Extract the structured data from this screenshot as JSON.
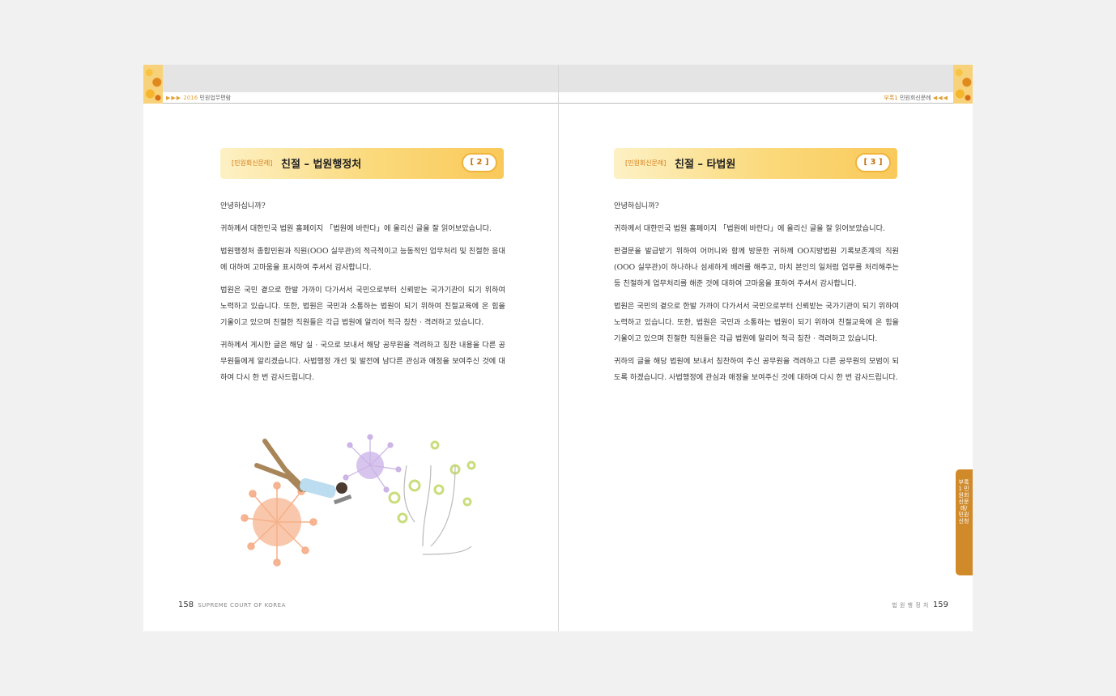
{
  "left_page": {
    "running_head": {
      "arrows": "▶▶▶",
      "year": "2016",
      "title": "민원업무편람"
    },
    "title_bar": {
      "category": "[민원회신문례]",
      "title": "친절 – 법원행정처",
      "number": "[ 2 ]"
    },
    "paragraphs": [
      "안녕하십니까?",
      "귀하께서 대한민국 법원 홈페이지 「법원에 바란다」에 올리신 글을 잘 읽어보았습니다.",
      "법원행정처 종합민원과 직원(OOO 실무관)의 적극적이고 능동적인 업무처리 및 친절한 응대에 대하여 고마움을 표시하여 주셔서 감사합니다.",
      "법원은 국민 곁으로 한발 가까이 다가서서 국민으로부터 신뢰받는 국가기관이 되기 위하여 노력하고 있습니다. 또한, 법원은 국민과 소통하는 법원이 되기 위하여 친절교육에 온 힘을 기울이고 있으며 친절한 직원들은 각급 법원에 알리어 적극 칭찬 · 격려하고 있습니다.",
      "귀하께서 게시한 글은 해당 실 · 국으로 보내서 해당 공무원을 격려하고 칭찬 내용을 다른 공무원들에게 알리겠습니다. 사법행정 개선 및 발전에 남다른 관심과 애정을 보여주신 것에 대하여 다시 한 번 감사드립니다."
    ],
    "footer": {
      "page_number": "158",
      "subtitle": "SUPREME COURT OF KOREA"
    }
  },
  "right_page": {
    "running_head": {
      "part": "부록1",
      "title": "민원회신문례",
      "arrows": "◀◀◀"
    },
    "title_bar": {
      "category": "[민원회신문례]",
      "title": "친절 – 타법원",
      "number": "[ 3 ]"
    },
    "paragraphs": [
      "안녕하십니까?",
      "귀하께서 대한민국 법원 홈페이지 「법원에 바란다」에 올리신 글을 잘 읽어보았습니다.",
      "판결문을 발급받기 위하여 어머니와 함께 방문한 귀하께 OO지방법원 기록보존계의 직원(OOO 실무관)이 하나하나 섬세하게 배려를 해주고, 마치 본인의 일처럼 업무를 처리해주는 등 친절하게 업무처리를 해준 것에 대하여 고마움을 표하여 주셔서 감사합니다.",
      "법원은 국민의 곁으로 한발 가까이 다가서서 국민으로부터 신뢰받는 국가기관이 되기 위하여 노력하고 있습니다. 또한, 법원은 국민과 소통하는 법원이 되기 위하여 친절교육에 온 힘을 기울이고 있으며 친절한 직원들은 각급 법원에 알리어 적극 칭찬 · 격려하고 있습니다.",
      "귀하의 글을 해당 법원에 보내서 칭찬하여 주신 공무원을 격려하고 다른 공무원의 모범이 되도록 하겠습니다. 사법행정에 관심과 애정을 보여주신 것에 대하여 다시 한 번 감사드립니다."
    ],
    "footer": {
      "subtitle": "법 원 행 정 처",
      "page_number": "159"
    },
    "side_tab": "부록1 민원회신문례/민원신청"
  }
}
